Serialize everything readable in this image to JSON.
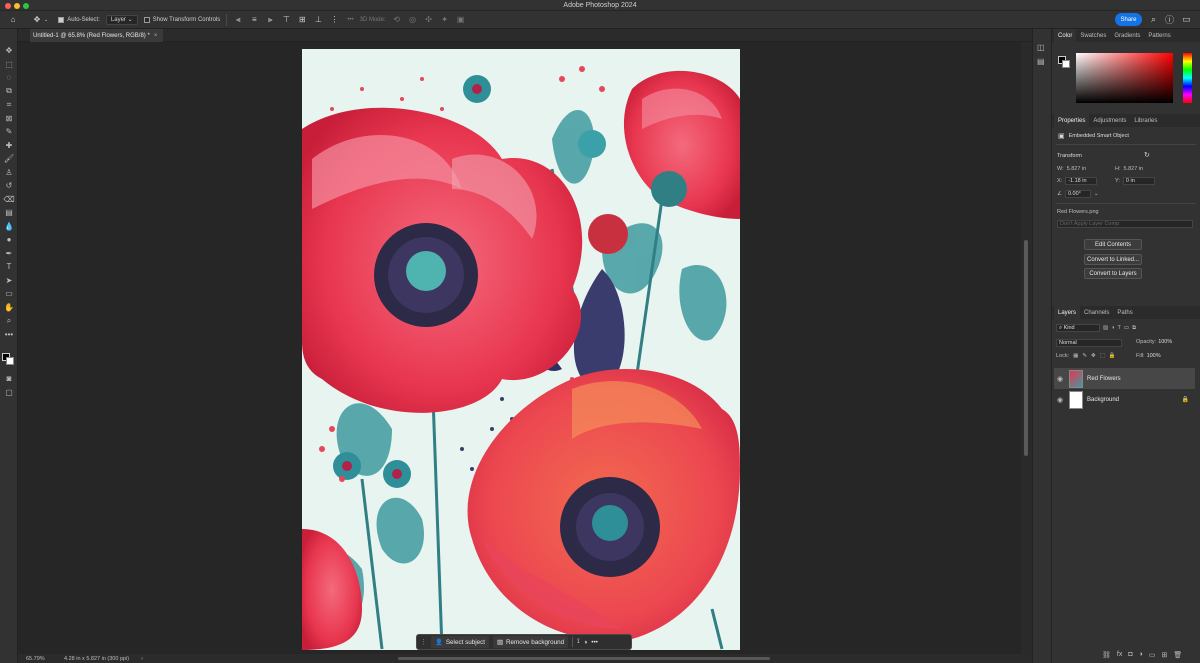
{
  "app": {
    "title": "Adobe Photoshop 2024"
  },
  "options_bar": {
    "auto_select_label": "Auto-Select:",
    "auto_select_target": "Layer",
    "show_transform_label": "Show Transform Controls",
    "mode_3d_label": "3D Mode:",
    "share_label": "Share"
  },
  "document": {
    "tab_label": "Untitled-1 @ 65.8% (Red Flowers, RGB/8) *",
    "zoom": "65.79%",
    "dimensions": "4.28 in x 5.827 in (300 ppi)"
  },
  "contextual_bar": {
    "select_subject": "Select subject",
    "remove_background": "Remove background",
    "more": "•••"
  },
  "color_panel": {
    "tabs": [
      "Color",
      "Swatches",
      "Gradients",
      "Patterns"
    ],
    "active_tab": "Color"
  },
  "properties_panel": {
    "tabs": [
      "Properties",
      "Adjustments",
      "Libraries"
    ],
    "object_type": "Embedded Smart Object",
    "transform_heading": "Transform",
    "w_label": "W:",
    "w_value": "5.827 in",
    "h_label": "H:",
    "h_value": "5.827 in",
    "x_label": "X:",
    "x_value": "-1.18 in",
    "y_label": "Y:",
    "y_value": "0 in",
    "angle_value": "0.00°",
    "file_name": "Red Flowers.png",
    "layer_comp_placeholder": "Don't Apply Layer Comp",
    "edit_contents": "Edit Contents",
    "convert_to_linked": "Convert to Linked...",
    "convert_to_layers": "Convert to Layers"
  },
  "layers_panel": {
    "tabs": [
      "Layers",
      "Channels",
      "Paths"
    ],
    "kind_label": "Kind",
    "blend_mode": "Normal",
    "opacity_label": "Opacity:",
    "opacity_value": "100%",
    "lock_label": "Lock:",
    "fill_label": "Fill:",
    "fill_value": "100%",
    "layers": [
      {
        "name": "Red Flowers"
      },
      {
        "name": "Background"
      }
    ]
  }
}
